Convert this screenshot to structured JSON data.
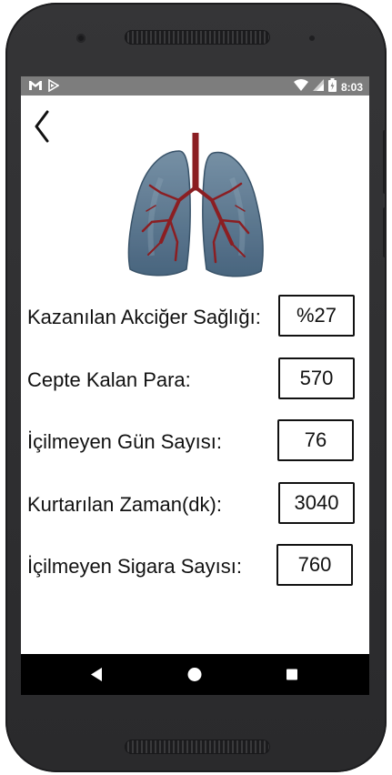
{
  "status_bar": {
    "time": "8:03",
    "icons": [
      "gmail-icon",
      "play-icon",
      "wifi-icon",
      "signal-icon",
      "battery-icon"
    ]
  },
  "header": {
    "back_icon": "chevron-left-icon"
  },
  "image": {
    "name": "lungs-illustration"
  },
  "stats": [
    {
      "label": "Kazanılan Akciğer Sağlığı:",
      "value": "%27"
    },
    {
      "label": "Cepte Kalan Para:",
      "value": "570"
    },
    {
      "label": "İçilmeyen Gün Sayısı:",
      "value": "76"
    },
    {
      "label": "Kurtarılan Zaman(dk):",
      "value": "3040"
    },
    {
      "label": "İçilmeyen Sigara Sayısı:",
      "value": "760"
    }
  ],
  "navigation_bar": {
    "buttons": [
      "back-triangle-icon",
      "home-circle-icon",
      "recents-square-icon"
    ]
  },
  "colors": {
    "status_bar": "#7d7d7d",
    "nav_bar": "#000000",
    "phone_frame": "#2c2c2e",
    "lung_fill": "#5b7a93",
    "airway": "#8b1e22"
  }
}
